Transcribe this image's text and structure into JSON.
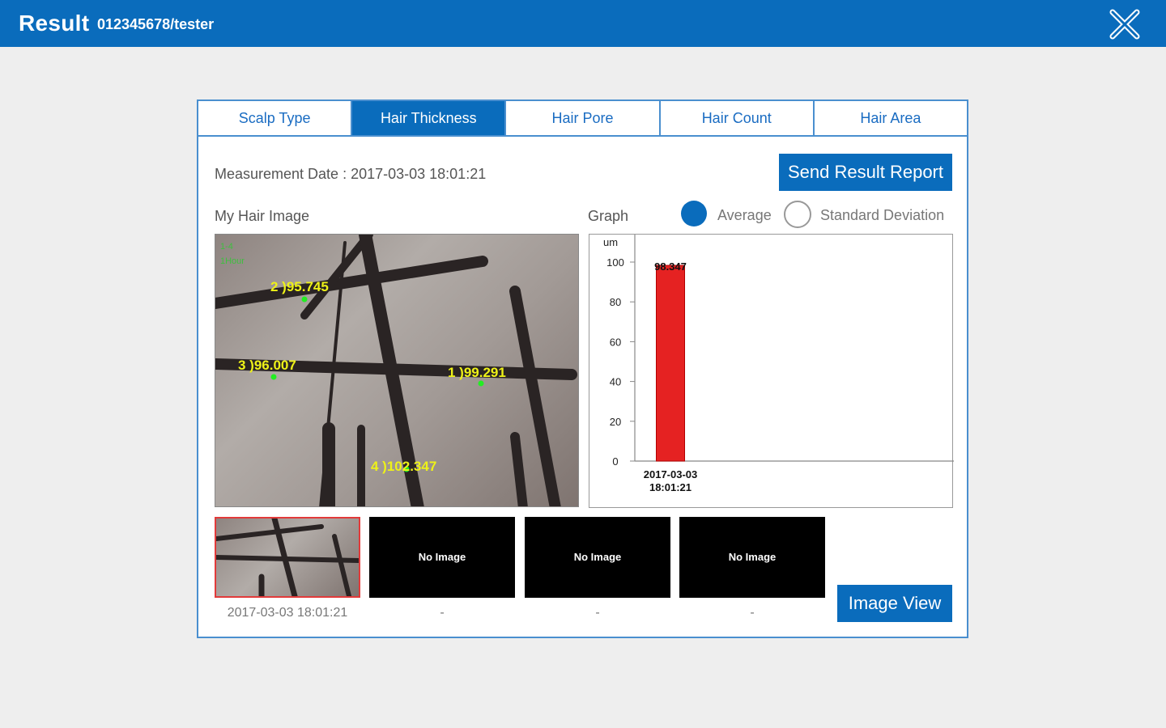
{
  "header": {
    "title": "Result",
    "user": "012345678/tester",
    "close_icon": "close-icon"
  },
  "tabs": [
    {
      "label": "Scalp Type",
      "active": false
    },
    {
      "label": "Hair Thickness",
      "active": true
    },
    {
      "label": "Hair Pore",
      "active": false
    },
    {
      "label": "Hair Count",
      "active": false
    },
    {
      "label": "Hair Area",
      "active": false
    }
  ],
  "measurement": {
    "label": "Measurement Date : 2017-03-03 18:01:21",
    "send_report_label": "Send Result Report"
  },
  "image_section": {
    "label": "My Hair Image",
    "overlay_corner": [
      "1-4",
      "1Hour"
    ],
    "measurements": [
      "2 )95.745",
      "3 )96.007",
      "1 )99.291",
      "4 )102.347"
    ]
  },
  "graph_section": {
    "label": "Graph",
    "radio_average_label": "Average",
    "radio_std_label": "Standard Deviation",
    "selected": "Average"
  },
  "thumbnails": [
    {
      "label": "",
      "date": "2017-03-03 18:01:21",
      "selected": true
    },
    {
      "label": "No Image",
      "date": "-",
      "selected": false
    },
    {
      "label": "No Image",
      "date": "-",
      "selected": false
    },
    {
      "label": "No Image",
      "date": "-",
      "selected": false
    }
  ],
  "image_view_label": "Image View",
  "chart_data": {
    "type": "bar",
    "ylabel": "um",
    "ylim": [
      0,
      100
    ],
    "yticks": [
      0,
      20,
      40,
      60,
      80,
      100
    ],
    "categories": [
      "2017-03-03 18:01:21"
    ],
    "values": [
      98.347
    ],
    "data_labels": [
      "98.347"
    ],
    "bar_color": "#e52222",
    "grid": false
  }
}
